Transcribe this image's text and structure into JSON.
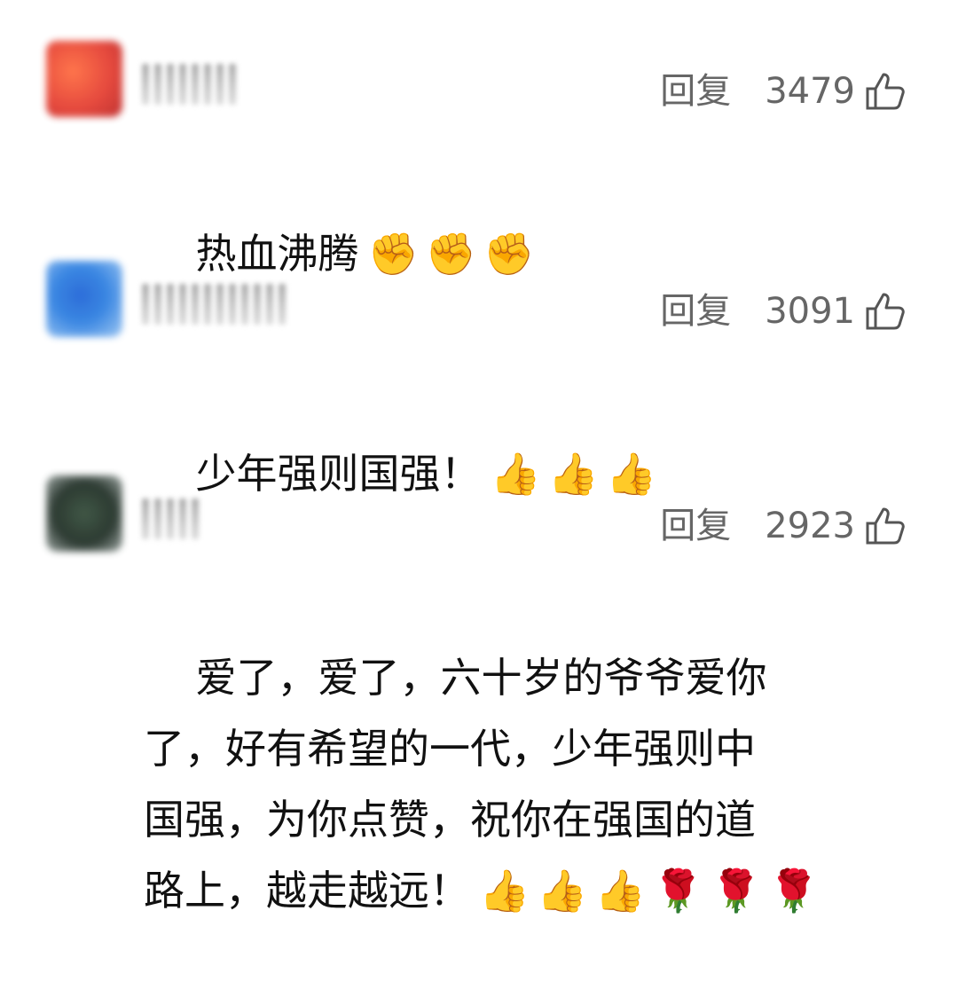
{
  "comments": [
    {
      "reply_label": "回复",
      "likes": "3479",
      "text": "热血沸腾",
      "emojis": "✊✊✊",
      "avatar_color": "#e43b2e"
    },
    {
      "reply_label": "回复",
      "likes": "3091",
      "text": "少年强则国强！",
      "emojis": "👍👍👍",
      "avatar_color": "#2a7de0"
    },
    {
      "reply_label": "回复",
      "likes": "2923",
      "text": "爱了，爱了，六十岁的爷爷爱你\n了，好有希望的一代，少年强则中\n国强，为你点赞，祝你在强国的道\n路上，越走越远！",
      "emojis": "👍👍👍🌹🌹🌹",
      "avatar_color": "#1b2a21"
    }
  ],
  "icons": {
    "like": "thumbs-up-outline-icon"
  }
}
